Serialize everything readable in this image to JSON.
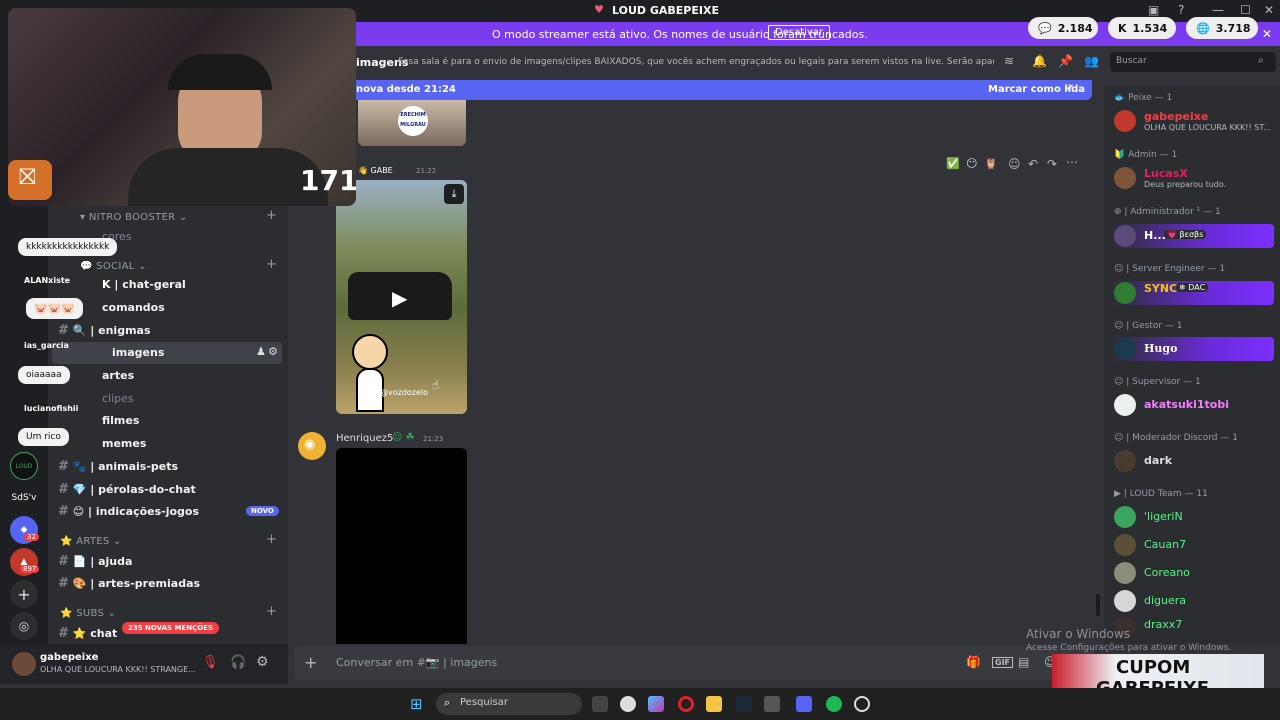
{
  "window": {
    "title": "LOUD GABEPEIXE"
  },
  "banner": {
    "message": "O modo streamer está ativo. Os nomes de usuário foram truncados.",
    "button": "Desativar"
  },
  "stats": [
    {
      "icon": "chat-bubble-icon",
      "value": "2.184"
    },
    {
      "icon": "kick-icon",
      "value": "1.534"
    },
    {
      "icon": "globe-icon",
      "value": "3.718"
    }
  ],
  "channel_header": {
    "name": "imagens",
    "topic": "Essa sala é para o envio de imagens/clipes BAIXADOS, que vocês achem engraçados ou legais para serem vistos na live. Serão apagados prints de o...",
    "search_placeholder": "Buscar"
  },
  "new_bar": {
    "text": "nova desde 21:24",
    "mark_read": "Marcar como lida"
  },
  "messages": [
    {
      "user": "GABE",
      "time": "21:22",
      "watermark": "@vozdozelo"
    },
    {
      "user": "Henriquez5",
      "time": "21:23"
    }
  ],
  "channel_list": {
    "categories": [
      {
        "name": "NITRO BOOSTER"
      },
      {
        "name": "SOCIAL"
      },
      {
        "name": "ARTES"
      },
      {
        "name": "SUBS"
      }
    ],
    "nitro_items": [
      "cores"
    ],
    "social_items": [
      "| chat-geral",
      "comandos",
      "enigmas",
      "imagens",
      "artes",
      "clipes",
      "filmes",
      "memes",
      "| animais-pets",
      "| pérolas-do-chat",
      "| indicações-jogos"
    ],
    "new_badge": "NOVO",
    "arte_items": [
      "| ajuda",
      "| artes-premiadas"
    ],
    "subs_items": [
      "chat"
    ],
    "mentions": "235 NOVAS MENÇÕES"
  },
  "user_panel": {
    "name": "gabepeixe",
    "status": "OLHA QUE LOUCURA KKK!! STRANGE..."
  },
  "input": {
    "placeholder": "Conversar em #📷 | imagens"
  },
  "members": {
    "groups": [
      {
        "role": "Peixe — 1",
        "members": [
          {
            "name": "gabepeixe",
            "status": "OLHA QUE LOUCURA KKK!! ST...",
            "color": "#f23f43"
          }
        ]
      },
      {
        "role": "Admin — 1",
        "members": [
          {
            "name": "LucasX",
            "status": "Deus preparou tudo.",
            "color": "#e91e63"
          }
        ]
      },
      {
        "role": "| Administrador ¹ — 1",
        "members": [
          {
            "name": "H...",
            "tag": "βεσβs",
            "color": "#ffffff"
          }
        ]
      },
      {
        "role": "| Server Engineer — 1",
        "members": [
          {
            "name": "SYNC",
            "tag": "DAC",
            "color": "#f1c40f"
          }
        ]
      },
      {
        "role": "| Gestor — 1",
        "members": [
          {
            "name": "Hugo",
            "color": "#ffffff"
          }
        ]
      },
      {
        "role": "| Supervisor — 1",
        "members": [
          {
            "name": "akatsuki1tobi",
            "color": "#f47fff"
          }
        ]
      },
      {
        "role": "| Moderador Discord — 1",
        "members": [
          {
            "name": "dark",
            "color": "#dbdee1"
          }
        ]
      },
      {
        "role": "| LOUD Team — 11",
        "members": [
          {
            "name": "'ligeriN",
            "color": "#57f287"
          },
          {
            "name": "Cauan7",
            "color": "#57f287"
          },
          {
            "name": "Coreano",
            "color": "#57f287"
          },
          {
            "name": "diguera",
            "color": "#57f287"
          },
          {
            "name": "draxx7",
            "color": "#57f287"
          }
        ]
      }
    ]
  },
  "overlay": {
    "viewer_count": "171",
    "chat": [
      {
        "user": "ALANxiste",
        "text": "kkkkkkkkkkkkkkkk"
      },
      {
        "user": "ias_garcia",
        "text": "oiaaaaa"
      },
      {
        "user": "lucianofishii",
        "text": "Um rico"
      }
    ],
    "rail_labels": [
      "SdS'v"
    ],
    "badges": [
      "32",
      "897"
    ]
  },
  "windows": {
    "line1": "Ativar o Windows",
    "line2": "Acesse Configurações para ativar o Windows."
  },
  "taskbar": {
    "search": "Pesquisar"
  },
  "cupom": {
    "line1": "CUPOM",
    "line2": "GABEPEIXE"
  },
  "colors": {
    "blurple": "#5865f2",
    "streamer": "#7b3cf0",
    "bg": "#313338",
    "sidebar": "#2b2d31"
  }
}
